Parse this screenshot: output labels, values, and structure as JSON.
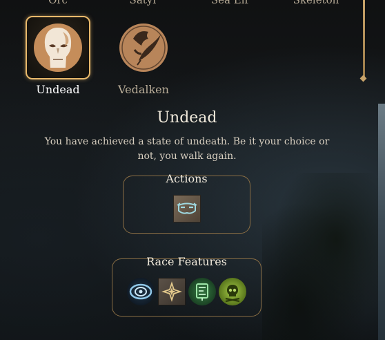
{
  "top_row": [
    "Orc",
    "Satyr",
    "Sea Elf",
    "Skeleton"
  ],
  "races": [
    {
      "name": "Undead",
      "icon": "undead-skull-icon",
      "selected": true
    },
    {
      "name": "Vedalken",
      "icon": "vedalken-icon",
      "selected": false
    }
  ],
  "detail": {
    "title": "Undead",
    "description": "You have achieved a state of undeath. Be it your choice or not, you walk again."
  },
  "actions": {
    "label": "Actions",
    "icons": [
      "mask-action-icon"
    ]
  },
  "features": {
    "label": "Race Features",
    "icons": [
      "darkvision-eye-icon",
      "sparkle-feature-icon",
      "rune-feature-icon",
      "poison-skull-icon"
    ]
  },
  "colors": {
    "accent_gold": "#e9b96b",
    "frame_bronze": "#8a6e44",
    "text_light": "#f0e9db",
    "poison_green": "#6ea12a"
  }
}
